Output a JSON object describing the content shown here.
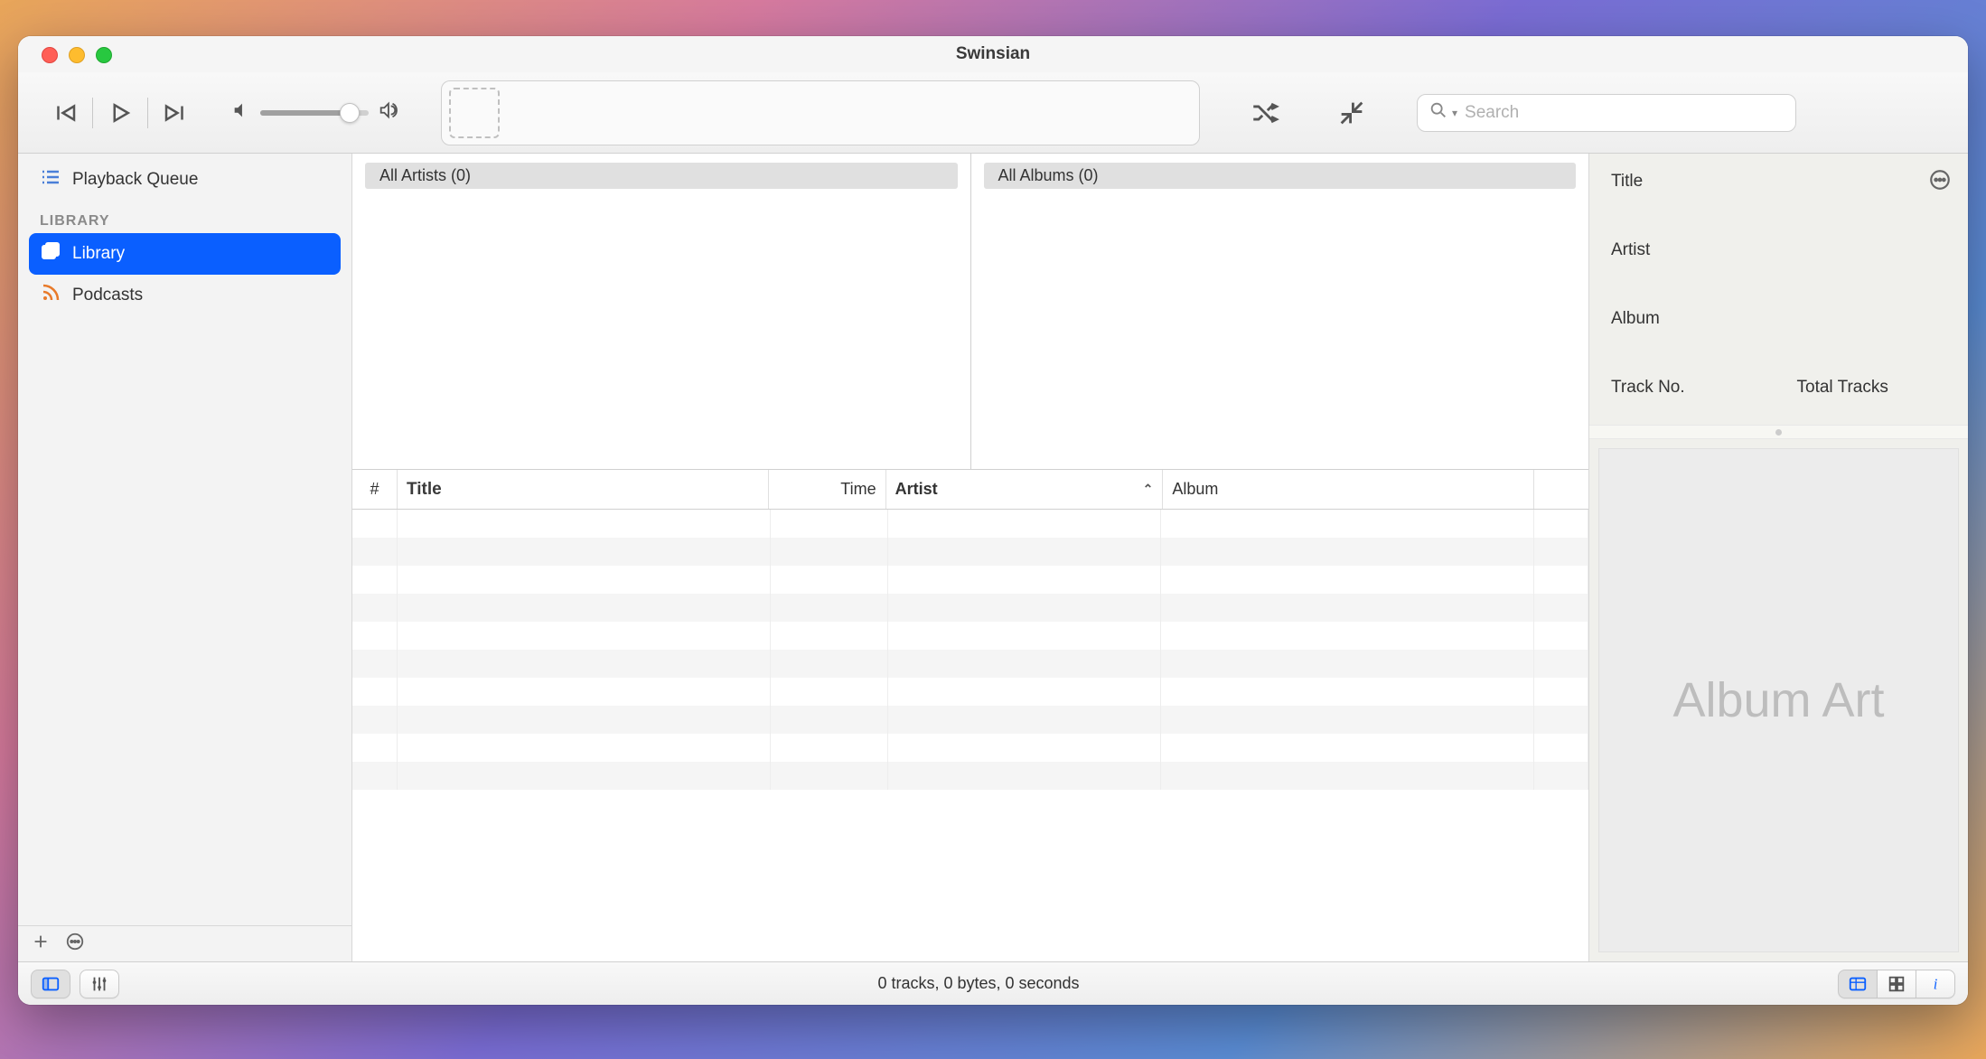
{
  "title": "Swinsian",
  "toolbar": {
    "search_placeholder": "Search"
  },
  "sidebar": {
    "playback_queue": "Playback Queue",
    "section_header": "LIBRARY",
    "items": [
      {
        "label": "Library",
        "selected": true
      },
      {
        "label": "Podcasts",
        "selected": false
      }
    ]
  },
  "browser": {
    "artists_label": "All Artists (0)",
    "albums_label": "All Albums (0)"
  },
  "columns": {
    "number": "#",
    "title": "Title",
    "time": "Time",
    "artist": "Artist",
    "album": "Album",
    "sort_column": "artist",
    "sort_dir": "asc"
  },
  "inspector": {
    "title_label": "Title",
    "artist_label": "Artist",
    "album_label": "Album",
    "track_no_label": "Track No.",
    "total_tracks_label": "Total Tracks",
    "album_art_placeholder": "Album Art"
  },
  "status": {
    "text": "0 tracks,  0 bytes,  0 seconds"
  }
}
